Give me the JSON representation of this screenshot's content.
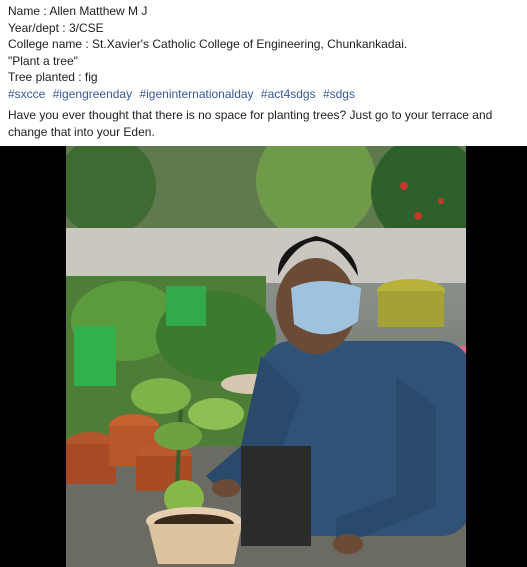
{
  "post": {
    "lines": [
      "Name : Allen Matthew M J",
      "Year/dept : 3/CSE",
      "College name : St.Xavier's Catholic College of Engineering, Chunkankadai.",
      "\"Plant a tree\"",
      "Tree planted : fig"
    ],
    "hashtags": [
      "#sxcce",
      "#igengreenday",
      "#igeninternationalday",
      "#act4sdgs",
      "#sdgs"
    ],
    "body": "Have you ever thought that there is no space for planting trees? Just go to your terrace and change that into your Eden.",
    "hashtag_color": "#385898"
  },
  "photo": {
    "subject": "person in blue checked shirt and face mask kneeling beside potted fig plant on a terrace garden"
  }
}
